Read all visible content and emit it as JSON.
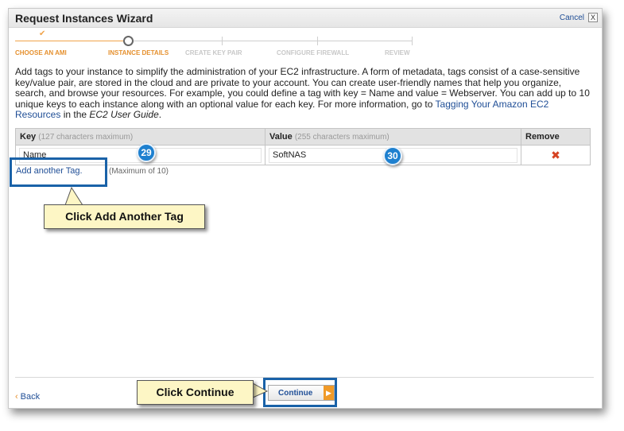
{
  "window": {
    "title": "Request Instances Wizard",
    "cancel_label": "Cancel",
    "close_glyph": "X"
  },
  "steps": [
    {
      "label": "CHOOSE AN AMI",
      "state": "done"
    },
    {
      "label": "INSTANCE DETAILS",
      "state": "active"
    },
    {
      "label": "CREATE KEY PAIR",
      "state": "pending"
    },
    {
      "label": "CONFIGURE FIREWALL",
      "state": "pending"
    },
    {
      "label": "REVIEW",
      "state": "pending"
    }
  ],
  "progress_check_glyph": "✔",
  "description": {
    "part1": "Add tags to your instance to simplify the administration of your EC2 infrastructure. A form of metadata, tags consist of a case-sensitive key/value pair, are stored in the cloud and are private to your account. You can create user-friendly names that help you organize, search, and browse your resources. For example, you could define a tag with key = Name and value = Webserver. You can add up to 10 unique keys to each instance along with an optional value for each key. For more information, go to ",
    "link": "Tagging Your Amazon EC2 Resources",
    "part2": " in the ",
    "guide": "EC2 User Guide",
    "part3": "."
  },
  "table": {
    "key_header": "Key",
    "key_hint": "(127 characters maximum)",
    "value_header": "Value",
    "value_hint": "(255 characters maximum)",
    "remove_header": "Remove",
    "rows": [
      {
        "key": "Name",
        "value": "SoftNAS",
        "remove_glyph": "✖"
      }
    ]
  },
  "add_tag": {
    "label": "Add another Tag.",
    "note": "(Maximum of 10)"
  },
  "back_label": "Back",
  "back_glyph": "‹",
  "continue": {
    "label": "Continue",
    "arrow_glyph": "▶"
  },
  "annotations": {
    "step_29": "29",
    "step_30": "30",
    "callout_add_tag": "Click Add Another Tag",
    "callout_continue": "Click Continue"
  },
  "colors": {
    "link": "#1f4e96",
    "progress_accent": "#e5902e",
    "annotation_blue": "#1a62a8",
    "callout_bg": "#fdf6c5",
    "remove_red": "#d64322"
  }
}
